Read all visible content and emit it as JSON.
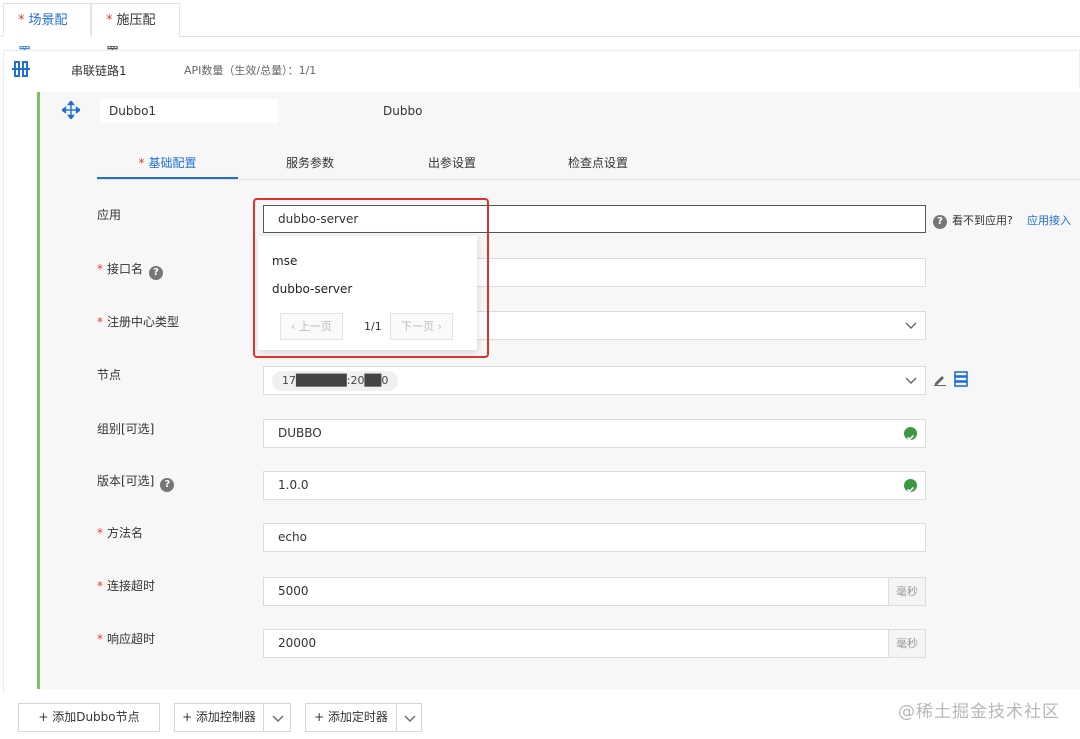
{
  "top_tabs": [
    {
      "label": "场景配置",
      "required": "*"
    },
    {
      "label": "施压配置",
      "required": "*"
    }
  ],
  "chain": {
    "name": "串联链路1",
    "api_count": "API数量（生效/总量）：1/1"
  },
  "node": {
    "name": "Dubbo1",
    "type": "Dubbo"
  },
  "inner_tabs": [
    "基础配置",
    "服务参数",
    "出参设置",
    "检查点设置"
  ],
  "form": {
    "app": {
      "label": "应用",
      "value": "dubbo-server",
      "help_text": "看不到应用?",
      "link": "应用接入"
    },
    "interface": {
      "label": "接口名",
      "value": ""
    },
    "registry": {
      "label": "注册中心类型",
      "value": ""
    },
    "node_addr": {
      "label": "节点",
      "value": "17██████:20██0"
    },
    "group": {
      "label": "组别[可选]",
      "value": "DUBBO"
    },
    "version": {
      "label": "版本[可选]",
      "value": "1.0.0"
    },
    "method": {
      "label": "方法名",
      "value": "echo"
    },
    "conn_timeout": {
      "label": "连接超时",
      "value": "5000",
      "unit": "毫秒"
    },
    "resp_timeout": {
      "label": "响应超时",
      "value": "20000",
      "unit": "毫秒"
    }
  },
  "dropdown": {
    "options": [
      "mse",
      "dubbo-server"
    ],
    "prev": "上一页",
    "page": "1/1",
    "next": "下一页"
  },
  "buttons": {
    "add_dubbo": "+ 添加Dubbo节点",
    "add_controller": "+ 添加控制器",
    "add_timer": "+ 添加定时器"
  },
  "required_mark": "*",
  "watermark": "@稀土掘金技术社区",
  "colors": {
    "accent": "#1e6fd9",
    "success": "#3a9a40",
    "panel_border": "#7cc35a",
    "highlight": "#e0322a"
  }
}
